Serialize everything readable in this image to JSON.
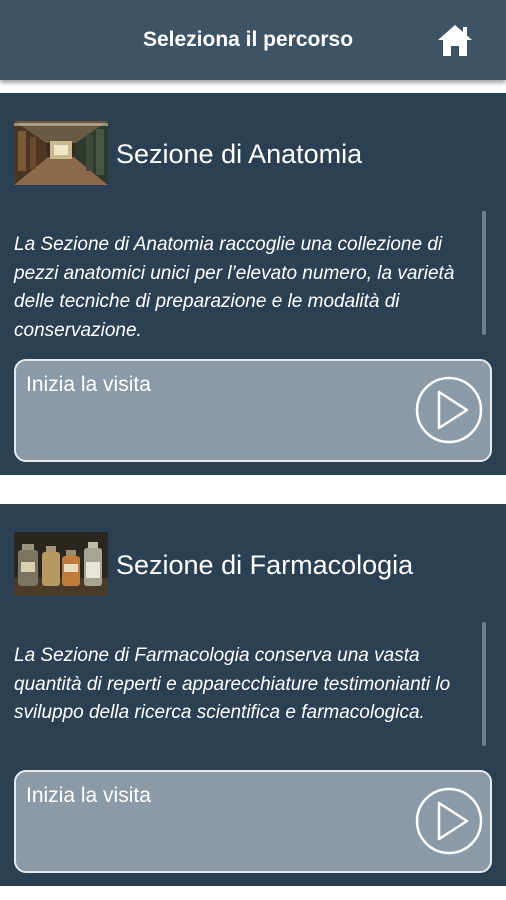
{
  "header": {
    "title": "Seleziona il percorso",
    "home_icon": "home-icon"
  },
  "colors": {
    "header_bg": "#3c5465",
    "card_bg": "#2b4052",
    "button_bg": "#8a9aa6"
  },
  "sections": [
    {
      "title": "Sezione di Anatomia",
      "description": "La Sezione di Anatomia raccoglie una collezione di pezzi anatomici unici per l’elevato numero, la varietà delle tecniche di preparazione e le modalità di conservazione.",
      "button_label": "Inizia la visita",
      "button_icon": "play-icon"
    },
    {
      "title": "Sezione di Farmacologia",
      "description": "La Sezione di Farmacologia conserva una vasta quantità di reperti e apparecchiature testimonianti lo sviluppo della ricerca scientifica e farmacologica.",
      "button_label": "Inizia la visita",
      "button_icon": "play-icon"
    }
  ]
}
